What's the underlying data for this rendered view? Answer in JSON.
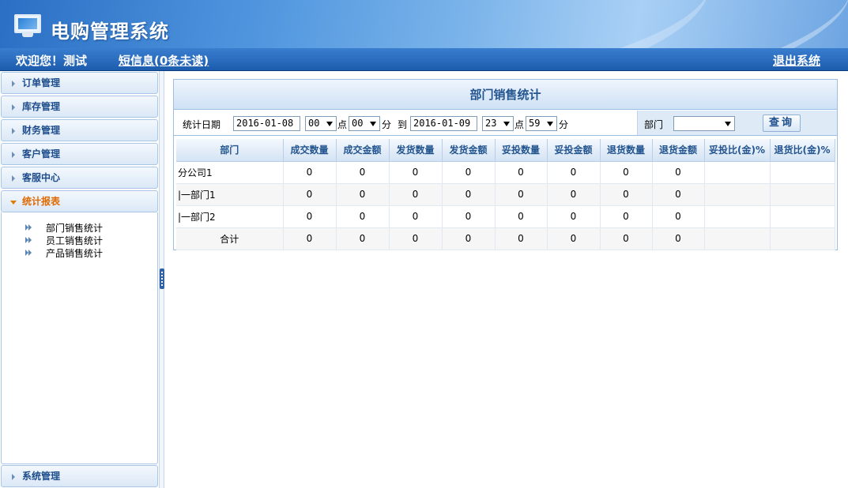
{
  "app": {
    "title": "电购管理系统"
  },
  "topbar": {
    "welcome": "欢迎您！测试",
    "messages": "短信息(0条未读)",
    "logout": "退出系统"
  },
  "sidebar": {
    "items": [
      {
        "label": "订单管理"
      },
      {
        "label": "库存管理"
      },
      {
        "label": "财务管理"
      },
      {
        "label": "客户管理"
      },
      {
        "label": "客服中心"
      },
      {
        "label": "统计报表",
        "active": true
      }
    ],
    "subitems": [
      {
        "label": "部门销售统计"
      },
      {
        "label": "员工销售统计"
      },
      {
        "label": "产品销售统计"
      }
    ],
    "bottom_item": {
      "label": "系统管理"
    }
  },
  "panel": {
    "title": "部门销售统计",
    "filter": {
      "date_label": "统计日期",
      "start_date": "2016-01-08",
      "start_hour": "00",
      "hour_unit": "点",
      "start_minute": "00",
      "minute_unit": "分",
      "to_label": "到",
      "end_date": "2016-01-09",
      "end_hour": "23",
      "end_minute": "59",
      "dept_label": "部门",
      "dept_value": "",
      "query_label": "查询"
    },
    "table": {
      "columns": [
        "部门",
        "成交数量",
        "成交金额",
        "发货数量",
        "发货金额",
        "妥投数量",
        "妥投金额",
        "退货数量",
        "退货金额",
        "妥投比(金)%",
        "退货比(金)%"
      ],
      "rows": [
        [
          "分公司1",
          "0",
          "0",
          "0",
          "0",
          "0",
          "0",
          "0",
          "0",
          "",
          ""
        ],
        [
          "|一部门1",
          "0",
          "0",
          "0",
          "0",
          "0",
          "0",
          "0",
          "0",
          "",
          ""
        ],
        [
          "|一部门2",
          "0",
          "0",
          "0",
          "0",
          "0",
          "0",
          "0",
          "0",
          "",
          ""
        ],
        [
          "合计",
          "0",
          "0",
          "0",
          "0",
          "0",
          "0",
          "0",
          "0",
          "",
          ""
        ]
      ]
    }
  },
  "icons": {
    "logo": "monitor-icon",
    "menu_arrow": "triangle-right-icon",
    "menu_arrow_active": "triangle-down-icon",
    "sub_bullet": "double-arrow-icon",
    "select": "chevron-down-icon"
  },
  "colors": {
    "header_blue": "#2a6fc4",
    "topbar_blue": "#1d5cad",
    "menu_text": "#1d4d8c",
    "active_menu": "#e06a00",
    "table_header_text": "#23558f"
  }
}
